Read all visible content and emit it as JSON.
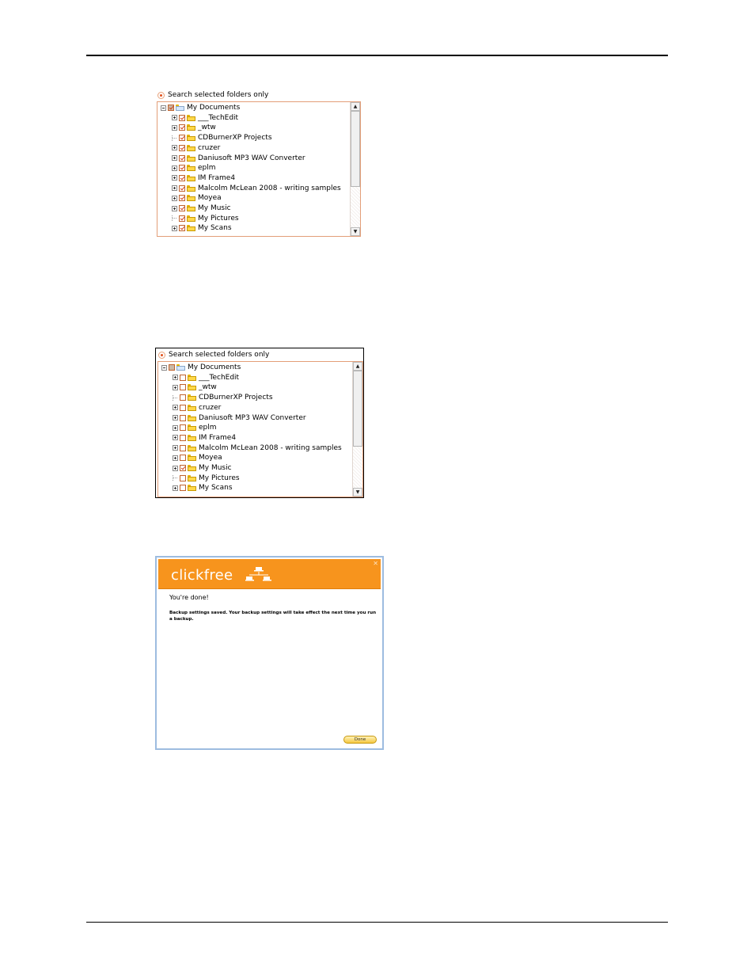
{
  "tree_panel_1": {
    "radio_label": "Search selected folders only",
    "items": [
      {
        "label": "My Documents",
        "checked": "partial-checked",
        "expander": "minus"
      },
      {
        "label": "___TechEdit",
        "checked": "checked",
        "expander": "plus"
      },
      {
        "label": "_wtw",
        "checked": "checked",
        "expander": "plus"
      },
      {
        "label": "CDBurnerXP Projects",
        "checked": "checked",
        "expander": "none"
      },
      {
        "label": "cruzer",
        "checked": "checked",
        "expander": "plus"
      },
      {
        "label": "Daniusoft MP3 WAV Converter",
        "checked": "checked",
        "expander": "plus"
      },
      {
        "label": "eplm",
        "checked": "checked",
        "expander": "plus"
      },
      {
        "label": "IM Frame4",
        "checked": "checked",
        "expander": "plus"
      },
      {
        "label": "Malcolm McLean 2008 - writing samples",
        "checked": "checked",
        "expander": "plus"
      },
      {
        "label": "Moyea",
        "checked": "checked",
        "expander": "plus"
      },
      {
        "label": "My Music",
        "checked": "checked",
        "expander": "plus"
      },
      {
        "label": "My Pictures",
        "checked": "checked",
        "expander": "none"
      },
      {
        "label": "My Scans",
        "checked": "checked",
        "expander": "plus"
      }
    ]
  },
  "tree_panel_2": {
    "radio_label": "Search selected folders only",
    "items": [
      {
        "label": "My Documents",
        "checked": "partial",
        "expander": "minus"
      },
      {
        "label": "___TechEdit",
        "checked": "unchecked",
        "expander": "plus"
      },
      {
        "label": "_wtw",
        "checked": "unchecked",
        "expander": "plus"
      },
      {
        "label": "CDBurnerXP Projects",
        "checked": "unchecked",
        "expander": "none"
      },
      {
        "label": "cruzer",
        "checked": "unchecked",
        "expander": "plus"
      },
      {
        "label": "Daniusoft MP3 WAV Converter",
        "checked": "unchecked",
        "expander": "plus"
      },
      {
        "label": "eplm",
        "checked": "unchecked",
        "expander": "plus"
      },
      {
        "label": "IM Frame4",
        "checked": "unchecked",
        "expander": "plus"
      },
      {
        "label": "Malcolm McLean 2008 - writing samples",
        "checked": "unchecked",
        "expander": "plus"
      },
      {
        "label": "Moyea",
        "checked": "unchecked",
        "expander": "plus"
      },
      {
        "label": "My Music",
        "checked": "checked",
        "expander": "plus"
      },
      {
        "label": "My Pictures",
        "checked": "unchecked",
        "expander": "none"
      },
      {
        "label": "My Scans",
        "checked": "unchecked",
        "expander": "plus"
      }
    ]
  },
  "dialog": {
    "brand": "clickfree",
    "title": "You're done!",
    "message": "Backup settings saved. Your backup settings will take effect the next time you run a backup.",
    "done_label": "Done",
    "header_color": "#f7941d"
  }
}
